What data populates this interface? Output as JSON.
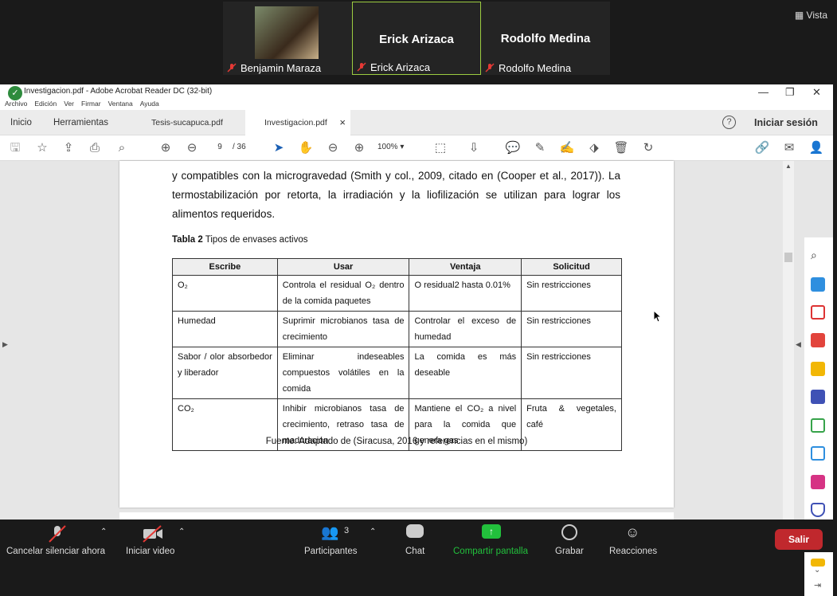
{
  "meeting": {
    "participants": [
      {
        "name": "Benjamin Maraza",
        "has_video": true
      },
      {
        "name": "Erick Arizaca",
        "display": "Erick Arizaca"
      },
      {
        "name": "Rodolfo Medina",
        "display": "Rodolfo Medina"
      }
    ],
    "vista_label": "Vista"
  },
  "acrobat": {
    "title": "Investigacion.pdf - Adobe Acrobat Reader DC (32-bit)",
    "menu": [
      "Archivo",
      "Edición",
      "Ver",
      "Firmar",
      "Ventana",
      "Ayuda"
    ],
    "tabs": [
      "Inicio",
      "Herramientas",
      "Tesis-sucapuca.pdf",
      "Investigacion.pdf"
    ],
    "tab_close": "×",
    "signin": "Iniciar sesión",
    "help_icon": "?",
    "page_current": "9",
    "page_total": "/ 36",
    "zoom": "100%"
  },
  "doc": {
    "para_lines": [
      "y compatibles con la microgravedad (Smith y col., 2009, citado en (Cooper et al., 2017)). La",
      "termostabilización por retorta, la irradiación y la liofilización se utilizan para lograr los",
      "alimentos requeridos."
    ],
    "table_caption_bold": "Tabla 2",
    "table_caption": " Tipos de envases activos",
    "table_headers": [
      "Escribe",
      "Usar",
      "Ventaja",
      "Solicitud"
    ],
    "rows": [
      [
        "O₂",
        "Controla el residual O₂ dentro de la comida paquetes",
        "O residual2 hasta 0.01%",
        "Sin restricciones"
      ],
      [
        "Humedad",
        "Suprimir microbianos tasa de crecimiento",
        "Controlar el exceso de humedad",
        "Sin restricciones"
      ],
      [
        "Sabor / olor absorbedor y liberador",
        "Eliminar indeseables compuestos volátiles en la comida",
        "La comida es más deseable",
        "Sin restricciones"
      ],
      [
        "CO₂",
        "Inhibir microbianos tasa de crecimiento, retraso tasa de maduración",
        "Mantiene el CO₂ a nivel para la comida que genera gas",
        "Fruta & vegetales, café"
      ]
    ],
    "source": "Fuente: Adaptado de (Siracusa, 2016 y referencias en el mismo)"
  },
  "zoom_bar": {
    "buttons": [
      "Cancelar silenciar ahora",
      "Iniciar video",
      "Participantes",
      "Chat",
      "Compartir pantalla",
      "Grabar",
      "Reacciones"
    ],
    "participants_count": "3",
    "leave": "Salir",
    "share_color": "#22c03c",
    "leave_color": "#c0282d"
  }
}
